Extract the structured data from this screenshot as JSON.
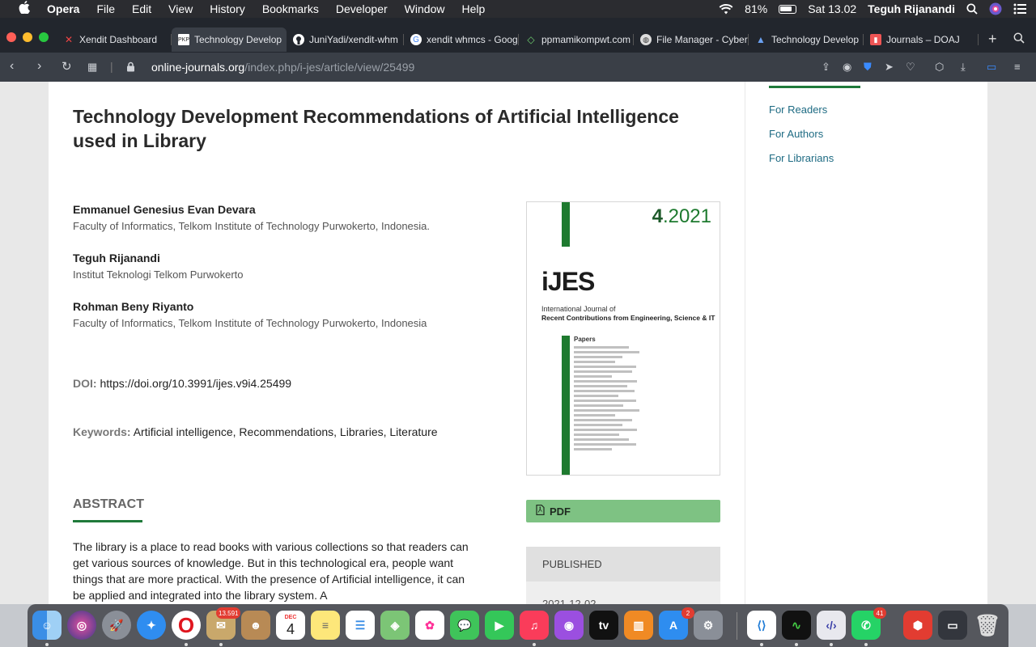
{
  "menubar": {
    "app": "Opera",
    "items": [
      "File",
      "Edit",
      "View",
      "History",
      "Bookmarks",
      "Developer",
      "Window",
      "Help"
    ],
    "battery": "81%",
    "clock": "Sat 13.02",
    "user": "Teguh Rijanandi"
  },
  "tabs": [
    {
      "label": "Xendit Dashboard"
    },
    {
      "label": "Technology Develop"
    },
    {
      "label": "JuniYadi/xendit-whm"
    },
    {
      "label": "xendit whmcs - Goog"
    },
    {
      "label": "ppmamikompwt.com"
    },
    {
      "label": "File Manager - Cyber"
    },
    {
      "label": "Technology Develop"
    },
    {
      "label": "Journals – DOAJ"
    }
  ],
  "address": {
    "host": "online-journals.org",
    "path": "/index.php/i-jes/article/view/25499"
  },
  "sidebar": {
    "links": [
      "For Readers",
      "For Authors",
      "For Librarians"
    ]
  },
  "article": {
    "title": "Technology Development Recommendations of Artificial Intelligence used in Library",
    "authors": [
      {
        "name": "Emmanuel Genesius Evan Devara",
        "affiliation": "Faculty of Informatics, Telkom Institute of Technology Purwokerto, Indonesia."
      },
      {
        "name": "Teguh Rijanandi",
        "affiliation": "Institut Teknologi Telkom Purwokerto"
      },
      {
        "name": "Rohman Beny Riyanto",
        "affiliation": "Faculty of Informatics, Telkom Institute of Technology Purwokerto, Indonesia"
      }
    ],
    "doi_label": "DOI:",
    "doi": "https://doi.org/10.3991/ijes.v9i4.25499",
    "keywords_label": "Keywords:",
    "keywords": "Artificial intelligence, Recommendations, Libraries, Literature",
    "abstract_heading": "ABSTRACT",
    "abstract": "The library is a place to read books with various collections so that readers can get various sources of knowledge. But in this technological era, people want things that are more practical. With the presence of Artificial intelligence, it can be applied and integrated into the library system. A",
    "cover": {
      "issue_number": "4",
      "issue_year": ".2021",
      "brand": "iJES",
      "subtitle1": "International Journal of",
      "subtitle2": "Recent Contributions from Engineering, Science & IT",
      "papers_label": "Papers"
    },
    "pdf_label": "PDF",
    "published_label": "PUBLISHED",
    "published_date": "2021-12-02"
  },
  "dock": {
    "badges": {
      "mail": "13.591",
      "appstore": "2",
      "whatsapp": "41"
    },
    "calendar_month": "DEC",
    "calendar_day": "4"
  },
  "colors": {
    "accent_green": "#1f7a3a",
    "pdf_button": "#7ec283",
    "link": "#1e6b83"
  }
}
